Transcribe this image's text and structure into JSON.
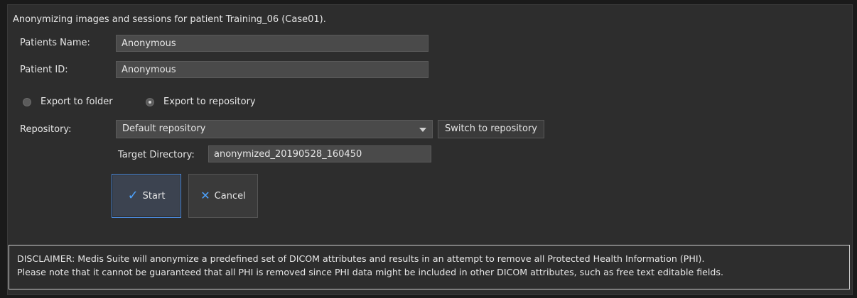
{
  "header": {
    "text": "Anonymizing images and sessions for patient Training_06 (Case01)."
  },
  "fields": {
    "patients_name_label": "Patients Name:",
    "patients_name_value": "Anonymous",
    "patient_id_label": "Patient ID:",
    "patient_id_value": "Anonymous"
  },
  "export": {
    "options": [
      {
        "label": "Export to folder",
        "selected": false
      },
      {
        "label": "Export to repository",
        "selected": true
      }
    ]
  },
  "repository": {
    "label": "Repository:",
    "selected": "Default repository",
    "switch_label": "Switch to repository"
  },
  "target": {
    "label": "Target Directory:",
    "value": "anonymized_20190528_160450"
  },
  "buttons": {
    "start_label": "Start",
    "cancel_label": "Cancel",
    "start_icon": "check-icon",
    "cancel_icon": "x-icon"
  },
  "disclaimer": {
    "line1": "DISCLAIMER: Medis Suite will anonymize a predefined set of DICOM attributes and results in an attempt to remove all Protected Health Information (PHI).",
    "line2": "Please note that it cannot be guaranteed that all PHI is removed since PHI data might be included in other DICOM attributes, such as free text editable fields."
  },
  "colors": {
    "background": "#2d2d2d",
    "input_background": "#4a4a4a",
    "accent": "#4da3ff"
  }
}
